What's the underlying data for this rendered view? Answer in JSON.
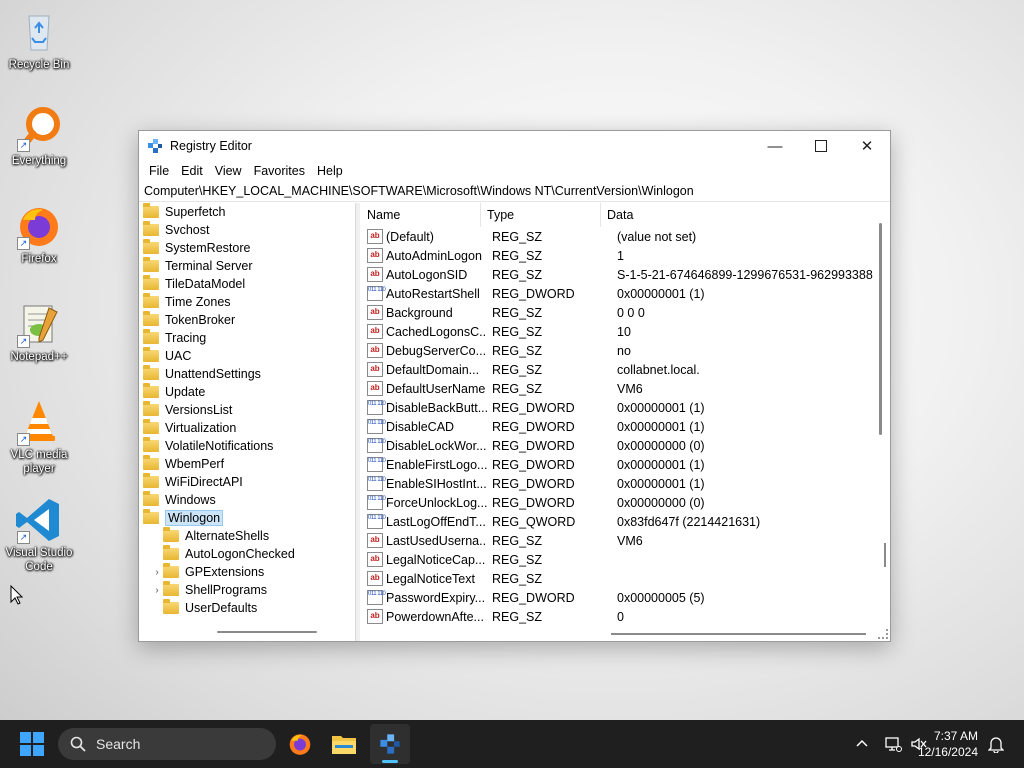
{
  "desktop": {
    "icons": [
      {
        "label": "Recycle Bin",
        "icon": "recycle-bin-icon"
      },
      {
        "label": "Everything",
        "icon": "everything-search-icon"
      },
      {
        "label": "Firefox",
        "icon": "firefox-icon"
      },
      {
        "label": "Notepad++",
        "icon": "notepadpp-icon"
      },
      {
        "label": "VLC media player",
        "icon": "vlc-icon"
      },
      {
        "label": "Visual Studio Code",
        "icon": "vscode-icon"
      }
    ]
  },
  "window": {
    "title": "Registry Editor",
    "menu": [
      "File",
      "Edit",
      "View",
      "Favorites",
      "Help"
    ],
    "address": "Computer\\HKEY_LOCAL_MACHINE\\SOFTWARE\\Microsoft\\Windows NT\\CurrentVersion\\Winlogon",
    "tree": [
      {
        "label": "Superfetch",
        "level": 0
      },
      {
        "label": "Svchost",
        "level": 0
      },
      {
        "label": "SystemRestore",
        "level": 0
      },
      {
        "label": "Terminal Server",
        "level": 0
      },
      {
        "label": "TileDataModel",
        "level": 0
      },
      {
        "label": "Time Zones",
        "level": 0
      },
      {
        "label": "TokenBroker",
        "level": 0
      },
      {
        "label": "Tracing",
        "level": 0
      },
      {
        "label": "UAC",
        "level": 0
      },
      {
        "label": "UnattendSettings",
        "level": 0
      },
      {
        "label": "Update",
        "level": 0
      },
      {
        "label": "VersionsList",
        "level": 0
      },
      {
        "label": "Virtualization",
        "level": 0
      },
      {
        "label": "VolatileNotifications",
        "level": 0
      },
      {
        "label": "WbemPerf",
        "level": 0
      },
      {
        "label": "WiFiDirectAPI",
        "level": 0
      },
      {
        "label": "Windows",
        "level": 0
      },
      {
        "label": "Winlogon",
        "level": 0,
        "selected": true
      },
      {
        "label": "AlternateShells",
        "level": 1
      },
      {
        "label": "AutoLogonChecked",
        "level": 1
      },
      {
        "label": "GPExtensions",
        "level": 1,
        "expandable": true
      },
      {
        "label": "ShellPrograms",
        "level": 1,
        "expandable": true
      },
      {
        "label": "UserDefaults",
        "level": 1
      }
    ],
    "columns": [
      "Name",
      "Type",
      "Data"
    ],
    "values": [
      {
        "name": "(Default)",
        "type": "REG_SZ",
        "data": "(value not set)",
        "kind": "sz"
      },
      {
        "name": "AutoAdminLogon",
        "type": "REG_SZ",
        "data": "1",
        "kind": "sz"
      },
      {
        "name": "AutoLogonSID",
        "type": "REG_SZ",
        "data": "S-1-5-21-674646899-1299676531-962993388",
        "kind": "sz"
      },
      {
        "name": "AutoRestartShell",
        "type": "REG_DWORD",
        "data": "0x00000001 (1)",
        "kind": "bin"
      },
      {
        "name": "Background",
        "type": "REG_SZ",
        "data": "0 0 0",
        "kind": "sz"
      },
      {
        "name": "CachedLogonsC...",
        "type": "REG_SZ",
        "data": "10",
        "kind": "sz"
      },
      {
        "name": "DebugServerCo...",
        "type": "REG_SZ",
        "data": "no",
        "kind": "sz"
      },
      {
        "name": "DefaultDomain...",
        "type": "REG_SZ",
        "data": "collabnet.local.",
        "kind": "sz"
      },
      {
        "name": "DefaultUserName",
        "type": "REG_SZ",
        "data": "VM6",
        "kind": "sz"
      },
      {
        "name": "DisableBackButt...",
        "type": "REG_DWORD",
        "data": "0x00000001 (1)",
        "kind": "bin"
      },
      {
        "name": "DisableCAD",
        "type": "REG_DWORD",
        "data": "0x00000001 (1)",
        "kind": "bin"
      },
      {
        "name": "DisableLockWor...",
        "type": "REG_DWORD",
        "data": "0x00000000 (0)",
        "kind": "bin"
      },
      {
        "name": "EnableFirstLogo...",
        "type": "REG_DWORD",
        "data": "0x00000001 (1)",
        "kind": "bin"
      },
      {
        "name": "EnableSIHostInt...",
        "type": "REG_DWORD",
        "data": "0x00000001 (1)",
        "kind": "bin"
      },
      {
        "name": "ForceUnlockLog...",
        "type": "REG_DWORD",
        "data": "0x00000000 (0)",
        "kind": "bin"
      },
      {
        "name": "LastLogOffEndT...",
        "type": "REG_QWORD",
        "data": "0x83fd647f (2214421631)",
        "kind": "bin"
      },
      {
        "name": "LastUsedUserna...",
        "type": "REG_SZ",
        "data": "VM6",
        "kind": "sz"
      },
      {
        "name": "LegalNoticeCap...",
        "type": "REG_SZ",
        "data": "",
        "kind": "sz"
      },
      {
        "name": "LegalNoticeText",
        "type": "REG_SZ",
        "data": "",
        "kind": "sz"
      },
      {
        "name": "PasswordExpiry...",
        "type": "REG_DWORD",
        "data": "0x00000005 (5)",
        "kind": "bin"
      },
      {
        "name": "PowerdownAfte...",
        "type": "REG_SZ",
        "data": "0",
        "kind": "sz"
      }
    ]
  },
  "taskbar": {
    "search_label": "Search",
    "time": "7:37 AM",
    "date": "12/16/2024",
    "apps": [
      "firefox-icon",
      "file-explorer-icon",
      "registry-editor-icon"
    ]
  },
  "colors": {
    "accent": "#3ea6ff",
    "taskbar": "#1f1f1f",
    "selection": "#cce4f7"
  }
}
